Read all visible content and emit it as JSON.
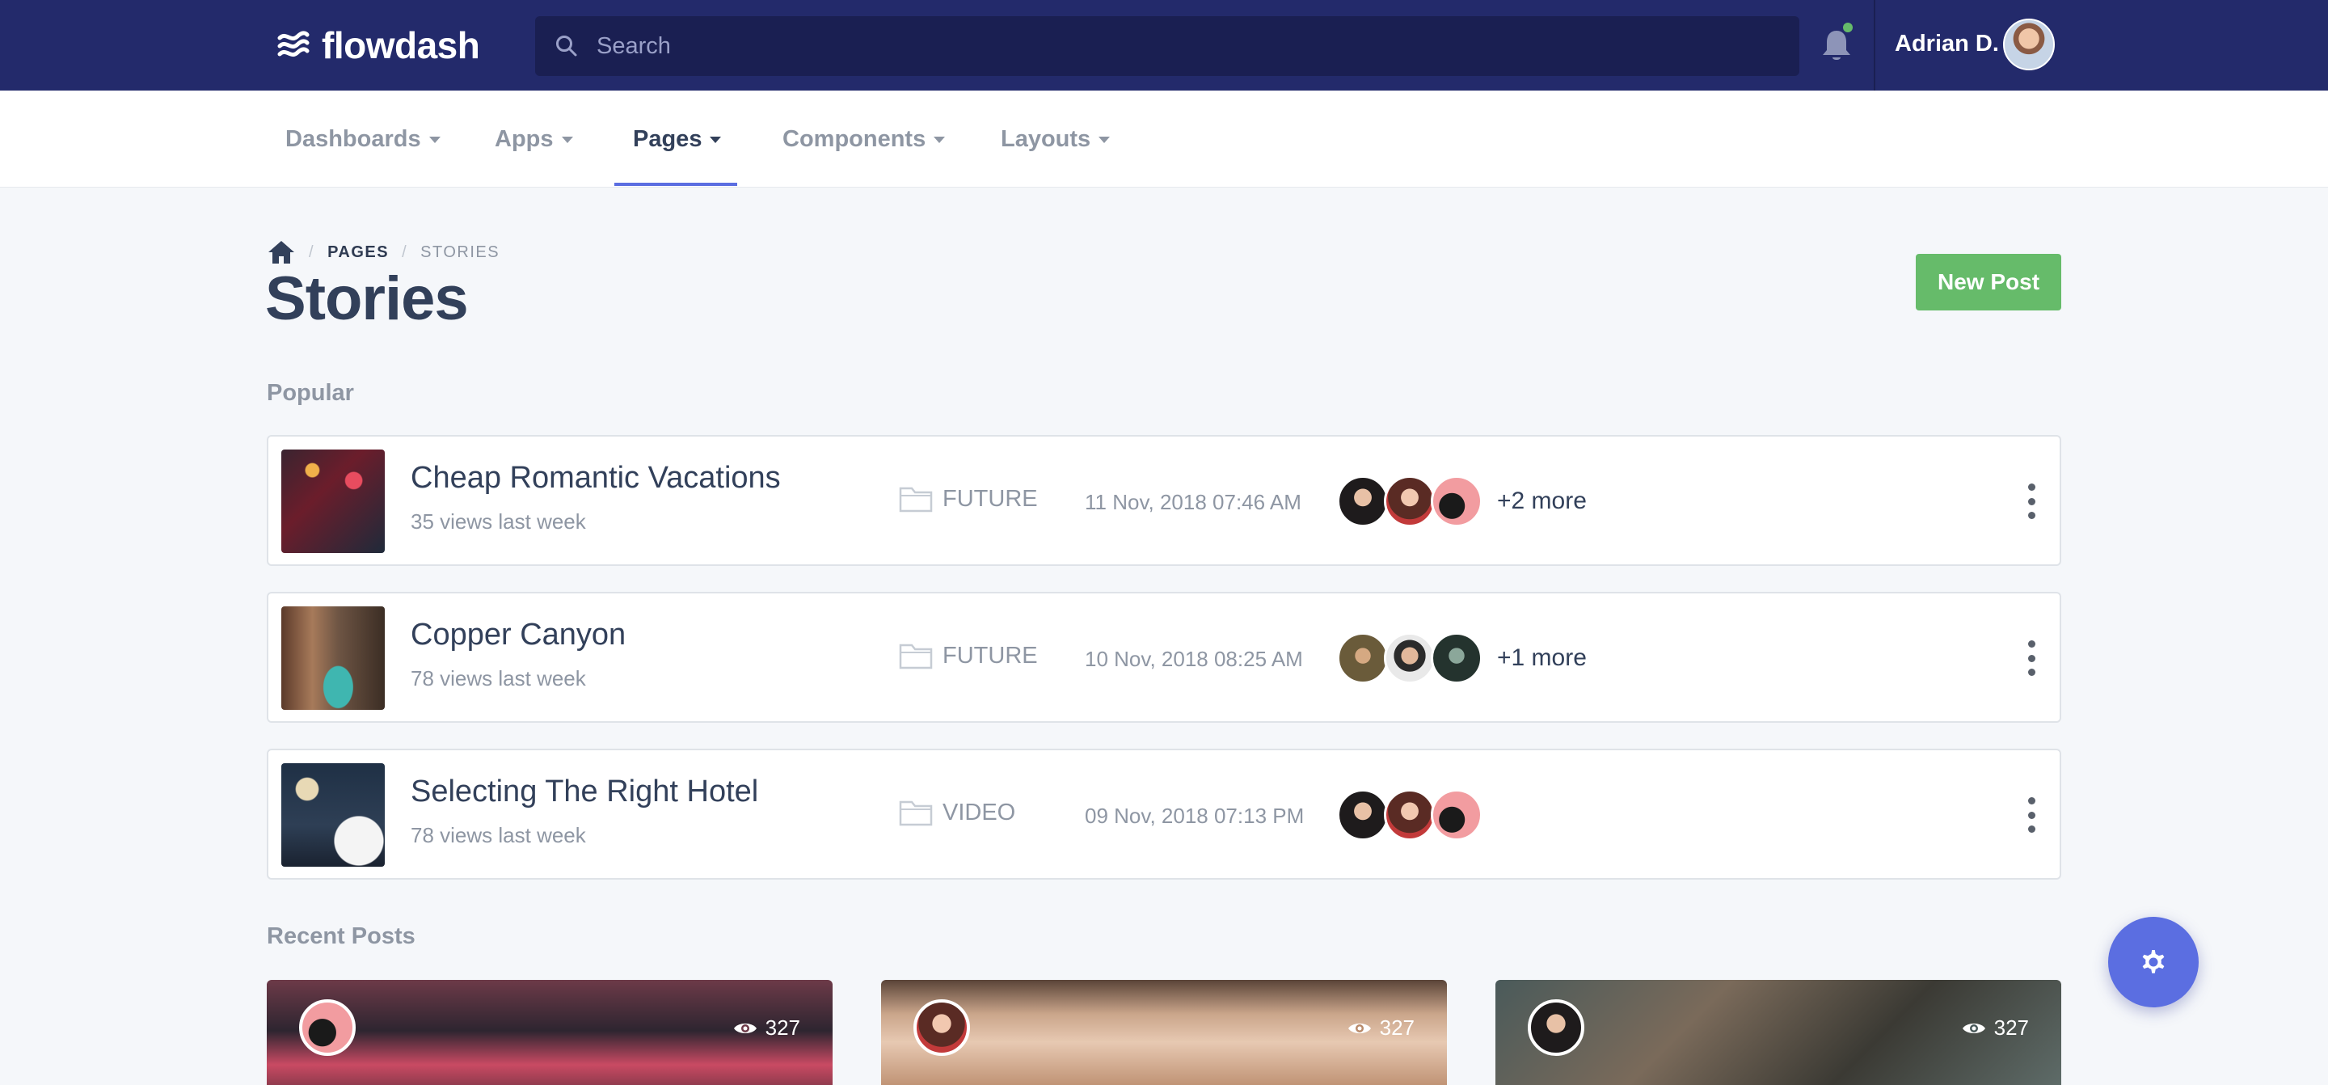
{
  "brand": {
    "name": "flowdash",
    "logo_icon": "waves-logo-icon"
  },
  "search": {
    "placeholder": "Search"
  },
  "user": {
    "name": "Adrian D."
  },
  "colors": {
    "topbar": "#232a6b",
    "accent": "#5b6ee1",
    "primary_button": "#66bb6a",
    "notification_dot": "#66bb6a"
  },
  "nav": {
    "items": [
      {
        "label": "Dashboards"
      },
      {
        "label": "Apps"
      },
      {
        "label": "Pages",
        "active": true
      },
      {
        "label": "Components"
      },
      {
        "label": "Layouts"
      }
    ]
  },
  "breadcrumb": {
    "home_icon": "home-icon",
    "items": [
      "PAGES",
      "STORIES"
    ]
  },
  "page": {
    "title": "Stories",
    "new_post_label": "New Post"
  },
  "popular": {
    "label": "Popular",
    "stories": [
      {
        "title": "Cheap Romantic Vacations",
        "views": "35 views last week",
        "category": "FUTURE",
        "date": "11 Nov, 2018 07:46 AM",
        "more": "+2 more"
      },
      {
        "title": "Copper Canyon",
        "views": "78 views last week",
        "category": "FUTURE",
        "date": "10 Nov, 2018 08:25 AM",
        "more": "+1 more"
      },
      {
        "title": "Selecting The Right Hotel",
        "views": "78 views last week",
        "category": "VIDEO",
        "date": "09 Nov, 2018 07:13 PM",
        "more": ""
      }
    ]
  },
  "recent": {
    "label": "Recent Posts",
    "cards": [
      {
        "views": "327"
      },
      {
        "views": "327"
      },
      {
        "views": "327"
      }
    ]
  },
  "settings_fab": {
    "icon": "gear-icon"
  }
}
